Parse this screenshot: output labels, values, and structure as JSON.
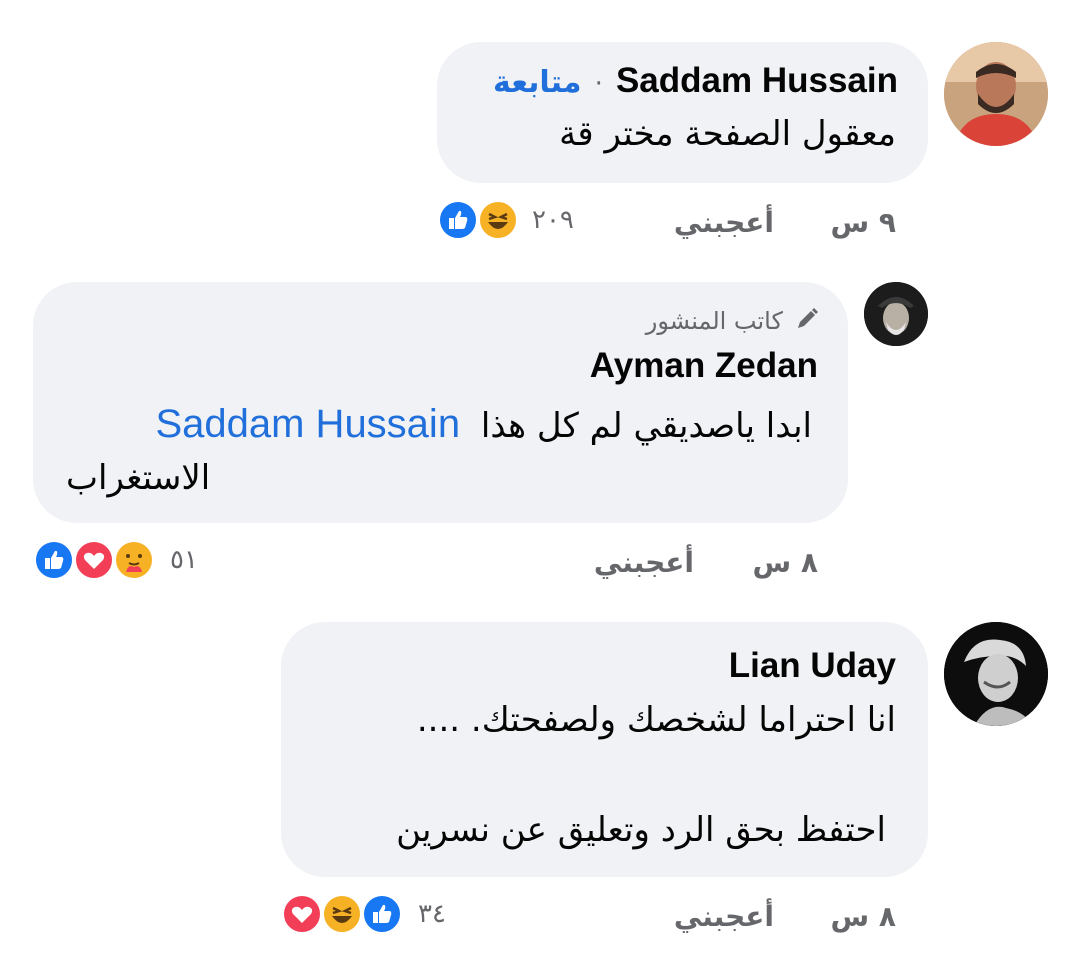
{
  "comments": [
    {
      "author": "Saddam Hussain",
      "separator": "·",
      "follow_label": "متابعة",
      "text": "معقول الصفحة مختر قة",
      "time": "٩ س",
      "like_label": "أعجبني",
      "reaction_count": "٢٠٩",
      "reactions": [
        "haha-icon",
        "like-icon"
      ]
    },
    {
      "badge_label": "كاتب المنشور",
      "author": "Ayman Zedan",
      "text_line1": "ابدا ياصديقي لم كل هذا",
      "mention": "Saddam Hussain",
      "text_line2": "الاستغراب",
      "time": "٨ س",
      "like_label": "أعجبني",
      "reaction_count": "٥١",
      "reactions": [
        "care-icon",
        "love-icon",
        "like-icon"
      ]
    },
    {
      "author": "Lian Uday",
      "text_line1": "انا احتراما  لشخصك ولصفحتك. ....",
      "text_line2": "احتفظ بحق الرد وتعليق عن نسرين",
      "time": "٨ س",
      "like_label": "أعجبني",
      "reaction_count": "٣٤",
      "reactions": [
        "love-icon",
        "haha-icon",
        "like-icon"
      ]
    }
  ],
  "colors": {
    "bubble": "#f0f2f5",
    "link": "#216fdb",
    "meta": "#65676b",
    "like": "#1877f2",
    "love": "#f33e58",
    "haha": "#f7b125"
  }
}
